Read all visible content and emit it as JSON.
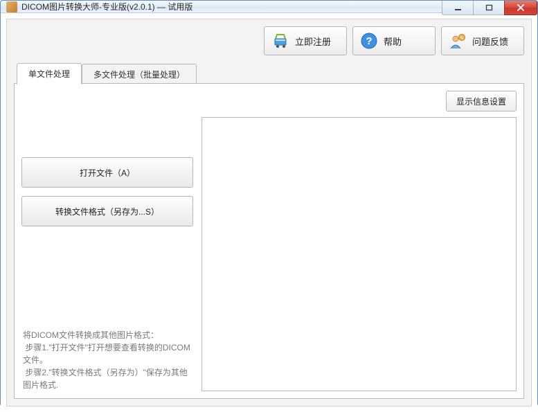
{
  "window": {
    "title": "DICOM图片转换大师-专业版(v2.0.1) — 试用版"
  },
  "toolbar": {
    "register_label": "立即注册",
    "help_label": "帮助",
    "feedback_label": "问题反馈"
  },
  "tabs": {
    "single": "单文件处理",
    "batch": "多文件处理（批量处理）"
  },
  "singleTab": {
    "open_file_label": "打开文件（A）",
    "convert_label": "转换文件格式（另存为...S）",
    "display_settings_label": "显示信息设置",
    "hint_text": "将DICOM文件转换成其他图片格式：\n 步骤1.\"打开文件\"打开想要查看转换的DICOM文件。\n 步骤2.\"转换文件格式（另存为）\"保存为其他图片格式."
  },
  "icons": {
    "register": "cart-icon",
    "help": "question-icon",
    "feedback": "user-bubble-icon"
  }
}
